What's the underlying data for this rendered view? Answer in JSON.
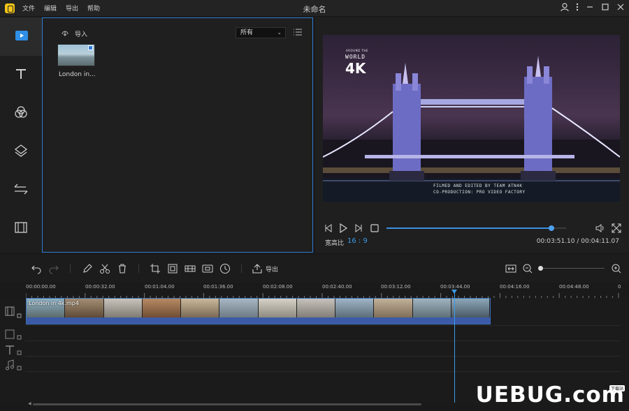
{
  "titlebar": {
    "window_title": "未命名",
    "menu": [
      "文件",
      "编辑",
      "导出",
      "帮助"
    ]
  },
  "media": {
    "import_label": "导入",
    "filter_value": "所有",
    "item_label": "London in..."
  },
  "preview": {
    "video_logo_top": "AROUND THE",
    "video_logo_world": "WORLD",
    "video_logo_4k": "4K",
    "video_credit_1": "FILMED AND EDITED BY TEAM ATN4K",
    "video_credit_2": "CO-PRODUCTION: PRO VIDEO FACTORY",
    "aspect_label": "宽高比",
    "aspect_value": "16 : 9",
    "timecode": "00:03:51.10 / 00:04:11.07",
    "progress_fraction": 0.92
  },
  "toolbar": {
    "export_label": "导出",
    "zoom_fraction": 0.0
  },
  "ruler": {
    "labels": [
      "00:00:00.00",
      "00:00:32.00",
      "00:01:04.00",
      "00:01:36.00",
      "00:02:08.00",
      "00:02:40.00",
      "00:03:12.00",
      "00:03:44.00",
      "00:04:16.00",
      "00:04:48.00",
      "0"
    ]
  },
  "timeline": {
    "clip_label": "London in 4k.mp4"
  },
  "watermark": {
    "text": "UEBUG.com",
    "badge": "下载站"
  },
  "colors": {
    "accent": "#3c9be6",
    "panel_border": "#2f7bd6",
    "background": "#1a1a1a"
  },
  "icons": [
    "logo-icon",
    "user-icon",
    "more-icon",
    "minimize-icon",
    "maximize-icon",
    "close-icon",
    "media-icon",
    "text-icon",
    "filters-icon",
    "overlays-icon",
    "transitions-icon",
    "film-icon",
    "import-icon",
    "list-view-icon",
    "prev-frame-icon",
    "play-icon",
    "next-frame-icon",
    "stop-icon",
    "volume-icon",
    "fullscreen-icon",
    "undo-icon",
    "redo-icon",
    "edit-icon",
    "cut-icon",
    "delete-icon",
    "crop-icon",
    "mosaic-icon",
    "freeze-icon",
    "snapshot-icon",
    "duration-icon",
    "export-icon",
    "fit-icon",
    "zoom-out-icon",
    "zoom-in-icon"
  ]
}
